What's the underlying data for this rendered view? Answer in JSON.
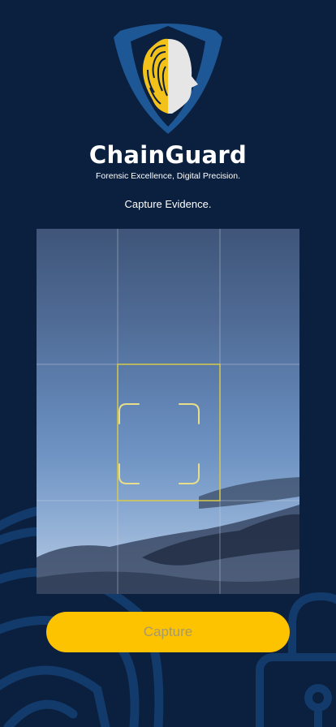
{
  "app": {
    "title": "ChainGuard",
    "tagline": "Forensic Excellence, Digital Precision."
  },
  "screen": {
    "instruction": "Capture Evidence."
  },
  "camera": {
    "grid": "3x3",
    "focus_icon": "scan-frame-icon"
  },
  "actions": {
    "capture_label": "Capture"
  },
  "icons": {
    "logo": "shield-fingerprint-face-logo",
    "background_left": "fingerprint-icon",
    "background_right": "padlock-icon"
  },
  "colors": {
    "background": "#0b1f3e",
    "accent": "#fdc200",
    "shield": "#1d5796",
    "face": "#e6e6e6",
    "focus_frame": "#d8c94a"
  }
}
